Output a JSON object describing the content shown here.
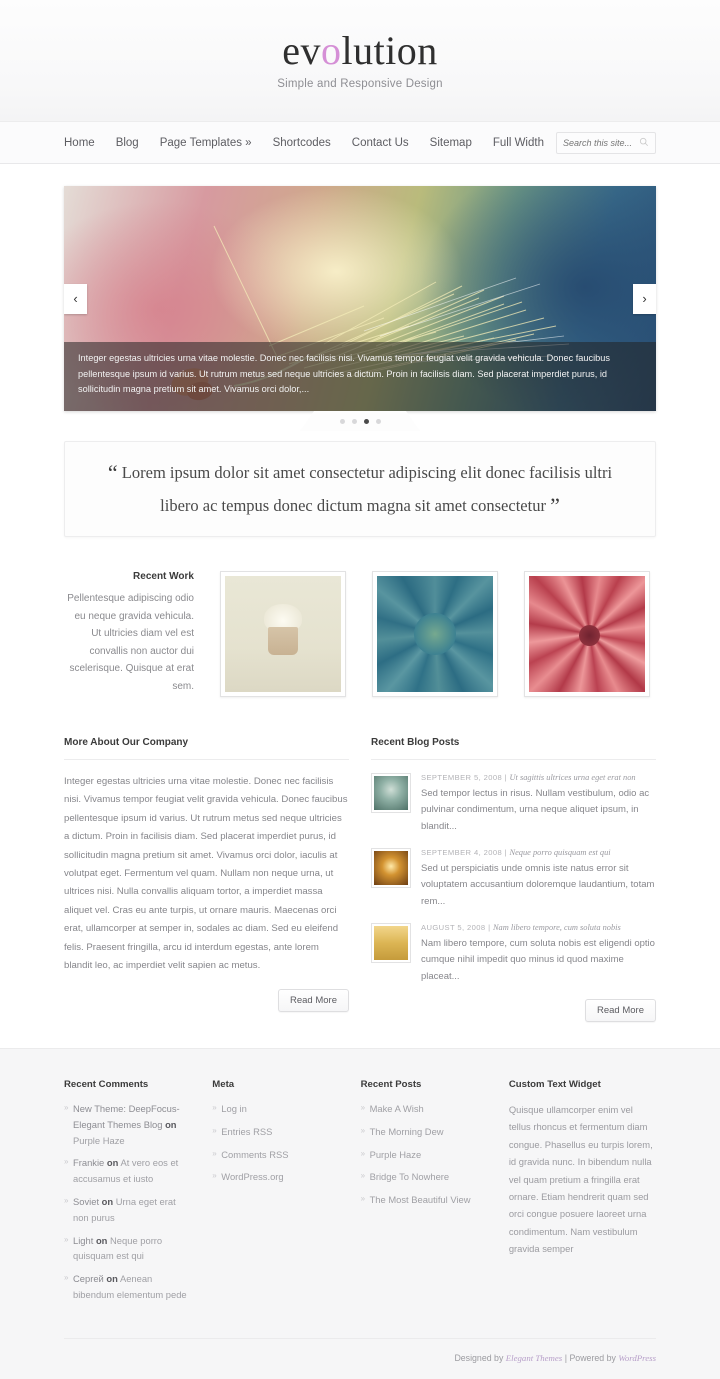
{
  "header": {
    "logo_pre": "ev",
    "logo_accent": "o",
    "logo_post": "lution",
    "tagline": "Simple and Responsive Design"
  },
  "nav": {
    "items": [
      {
        "label": "Home"
      },
      {
        "label": "Blog"
      },
      {
        "label": "Page Templates »"
      },
      {
        "label": "Shortcodes"
      },
      {
        "label": "Contact Us"
      },
      {
        "label": "Sitemap"
      },
      {
        "label": "Full Width"
      }
    ],
    "search": {
      "placeholder": "Search this site...",
      "value": "",
      "icon": "search-icon"
    }
  },
  "slider": {
    "caption": "Integer egestas ultricies urna vitae molestie. Donec nec facilisis nisi. Vivamus tempor feugiat velit gravida vehicula. Donec faucibus pellentesque ipsum id varius. Ut rutrum metus sed neque ultricies a dictum. Proin in facilisis diam. Sed placerat imperdiet purus, id sollicitudin magna pretium sit amet. Vivamus orci dolor,...",
    "prev_icon": "chevron-left-icon",
    "next_icon": "chevron-right-icon",
    "prev_glyph": "‹",
    "next_glyph": "›",
    "dots": 4,
    "active_dot": 3,
    "image_alt": "wheat-stalk-with-butterfly"
  },
  "quote": {
    "open_mark": "“",
    "close_mark": "”",
    "text": "Lorem ipsum dolor sit amet consectetur adipiscing elit donec facilisis ultri libero ac tempus donec dictum magna sit amet consectetur"
  },
  "recent_work": {
    "title": "Recent Work",
    "description": "Pellentesque adipiscing odio eu neque gravida vehicula. Ut ultricies diam vel est convallis non auctor dui scelerisque. Quisque at erat sem.",
    "images": [
      {
        "alt": "cupcake-photo"
      },
      {
        "alt": "blue-succulent-photo"
      },
      {
        "alt": "red-rose-photo"
      }
    ]
  },
  "about": {
    "title": "More About Our Company",
    "paragraph": "Integer egestas ultricies urna vitae molestie. Donec nec facilisis nisi. Vivamus tempor feugiat velit gravida vehicula. Donec faucibus pellentesque ipsum id varius. Ut rutrum metus sed neque ultricies a dictum. Proin in facilisis diam. Sed placerat imperdiet purus, id sollicitudin magna pretium sit amet. Vivamus orci dolor, iaculis at volutpat eget. Fermentum vel quam. Nullam non neque urna, ut ultrices nisi. Nulla convallis aliquam tortor, a imperdiet massa aliquet vel. Cras eu ante turpis, ut ornare mauris. Maecenas orci erat, ullamcorper at semper in, sodales ac diam. Sed eu eleifend felis. Praesent fringilla, arcu id interdum egestas, ante lorem blandit leo, ac imperdiet velit sapien ac metus.",
    "read_more": "Read More"
  },
  "blog": {
    "title": "Recent Blog Posts",
    "read_more": "Read More",
    "posts": [
      {
        "date": "SEPTEMBER 5, 2008",
        "separator": "|",
        "title": "Ut sagittis ultrices urna eget erat non",
        "excerpt": "Sed tempor lectus in risus. Nullam vestibulum, odio ac pulvinar condimentum, urna neque aliquet ipsum, in blandit...",
        "thumb_alt": "misty-forest-thumb"
      },
      {
        "date": "SEPTEMBER 4, 2008",
        "separator": "|",
        "title": "Neque porro quisquam est qui",
        "excerpt": "Sed ut perspiciatis unde omnis iste natus error sit voluptatem accusantium doloremque laudantium, totam rem...",
        "thumb_alt": "golden-forest-thumb"
      },
      {
        "date": "AUGUST 5, 2008",
        "separator": "|",
        "title": "Nam libero tempore, cum soluta nobis",
        "excerpt": "Nam libero tempore, cum soluta nobis est eligendi optio cumque nihil impedit quo minus id quod maxime placeat...",
        "thumb_alt": "wheat-field-thumb"
      }
    ]
  },
  "footer": {
    "recent_comments": {
      "title": "Recent Comments",
      "items": [
        {
          "author": "New Theme: DeepFocus- Elegant Themes Blog",
          "on": "on",
          "post": "Purple Haze"
        },
        {
          "author": "Frankie",
          "on": "on",
          "post": "At vero eos et accusamus et iusto"
        },
        {
          "author": "Soviet",
          "on": "on",
          "post": "Urna eget erat non purus"
        },
        {
          "author": "Light",
          "on": "on",
          "post": "Neque porro quisquam est qui"
        },
        {
          "author": "Cepreй",
          "on": "on",
          "post": "Aenean bibendum elementum pede"
        }
      ]
    },
    "meta": {
      "title": "Meta",
      "items": [
        "Log in",
        "Entries RSS",
        "Comments RSS",
        "WordPress.org"
      ]
    },
    "recent_posts": {
      "title": "Recent Posts",
      "items": [
        "Make A Wish",
        "The Morning Dew",
        "Purple Haze",
        "Bridge To Nowhere",
        "The Most Beautiful View"
      ]
    },
    "custom_text": {
      "title": "Custom Text Widget",
      "text": "Quisque ullamcorper enim vel tellus rhoncus et fermentum diam congue. Phasellus eu turpis lorem, id gravida nunc. In bibendum nulla vel quam pretium a fringilla erat ornare. Etiam hendrerit quam sed orci congue posuere laoreet urna condimentum. Nam vestibulum gravida semper"
    },
    "credits": {
      "designed_by": "Designed by",
      "designer": "Elegant Themes",
      "divider": "|",
      "powered_by": "Powered by",
      "platform": "WordPress"
    }
  },
  "colors": {
    "accent": "#d58fd6",
    "link": "#b79fc9",
    "text": "#86868b",
    "heading": "#3b3b3b"
  }
}
